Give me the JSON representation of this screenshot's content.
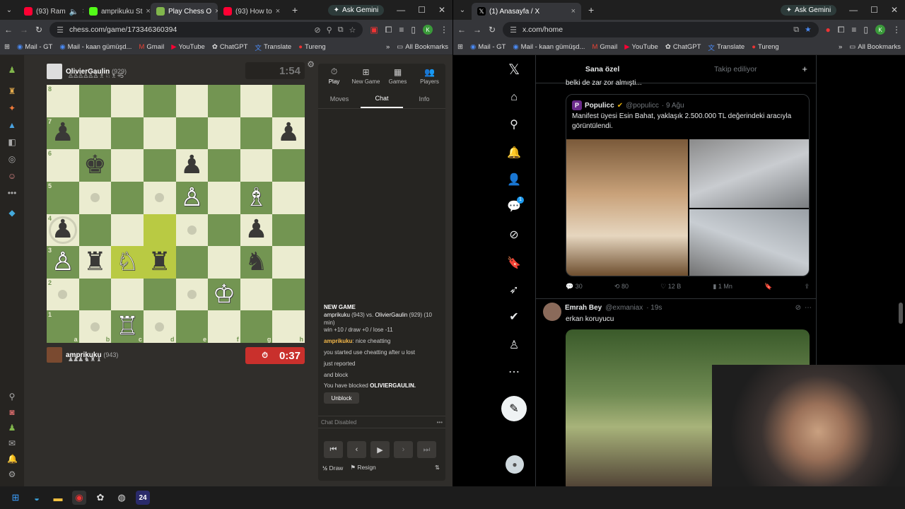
{
  "left_window": {
    "tabs": [
      {
        "label": "(93) Ram",
        "favicon_color": "#ff0033"
      },
      {
        "label": "amprikuku St",
        "favicon_color": "#53fc18"
      },
      {
        "label": "Play Chess O",
        "favicon_color": "#81b64c",
        "active": true
      },
      {
        "label": "(93) How to",
        "favicon_color": "#ff0033"
      }
    ],
    "gemini_label": "Ask Gemini",
    "url": "chess.com/game/173346360394",
    "profile_initial": "K",
    "bookmarks": [
      "Mail - GT",
      "Mail - kaan gümüşd...",
      "Gmail",
      "YouTube",
      "ChatGPT",
      "Translate",
      "Tureng"
    ],
    "all_bookmarks": "All Bookmarks"
  },
  "chess": {
    "opponent": {
      "name": "OlivierGaulin",
      "rating": "(929)",
      "caps": "♙♙♙♙♙♙ ♗ ♘ ♗ +5"
    },
    "opponent_clock": "1:54",
    "player": {
      "name": "amprikuku",
      "rating": "(943)",
      "caps": "♟♟♟ ♞ ♜ ♝"
    },
    "player_clock": "0:37",
    "ranks": [
      "8",
      "7",
      "6",
      "5",
      "4",
      "3",
      "2",
      "1"
    ],
    "files": [
      "a",
      "b",
      "c",
      "d",
      "e",
      "f",
      "g",
      "h"
    ],
    "side_tabs": [
      {
        "icon": "⏱",
        "label": "Play"
      },
      {
        "icon": "⊞",
        "label": "New Game"
      },
      {
        "icon": "▦",
        "label": "Games"
      },
      {
        "icon": "👥",
        "label": "Players"
      }
    ],
    "sub_tabs": [
      "Moves",
      "Chat",
      "Info"
    ],
    "chat": {
      "title": "NEW GAME",
      "matchup_a": "amprikuku",
      "matchup_a_rating": "(943) vs.",
      "matchup_b": "OlivierGaulin",
      "matchup_b_rating": "(929) (10 min)",
      "result_line": "win +10 / draw +0 / lose -11",
      "msg_user": "amprikuku",
      "msg_text": ": nice cheatting",
      "line1": "you started use cheatting after u lost",
      "line2": "just reported",
      "line3": "and block",
      "blocked_prefix": "You have blocked ",
      "blocked_name": "OLIVIERGAULIN.",
      "unblock": "Unblock"
    },
    "chat_disabled": "Chat Disabled",
    "draw": "Draw",
    "draw_prefix": "½",
    "resign": "Resign"
  },
  "right_window": {
    "tab_label": "(1) Anasayfa / X",
    "gemini_label": "Ask Gemini",
    "url": "x.com/home",
    "profile_initial": "K",
    "bookmarks": [
      "Mail - GT",
      "Mail - kaan gümüşd...",
      "Gmail",
      "YouTube",
      "ChatGPT",
      "Translate",
      "Tureng"
    ],
    "all_bookmarks": "All Bookmarks"
  },
  "x": {
    "tabs": [
      "Sana özel",
      "Takip ediliyor"
    ],
    "cut_text": "belki de zar zor almışti...",
    "quote": {
      "name": "Populicc",
      "handle": "@populicc",
      "date": "· 9 Ağu",
      "text": "Manifest üyesi Esin Bahat, yaklaşık 2.500.000 TL değerindeki aracıyla görüntülendi."
    },
    "stats": {
      "replies": "30",
      "reposts": "80",
      "likes": "12 B",
      "views": "1 Mn"
    },
    "tweet2": {
      "name": "Emrah Bey",
      "handle": "@exmaniax",
      "time": "· 19s",
      "text": "erkan koruyucu"
    },
    "notifications_badge": "1"
  },
  "taskbar": {
    "badge": "24"
  },
  "colors": {
    "board_light": "#ebecd0",
    "board_dark": "#739552",
    "highlight": "#b9ca43",
    "clock_active": "#c9302c"
  }
}
